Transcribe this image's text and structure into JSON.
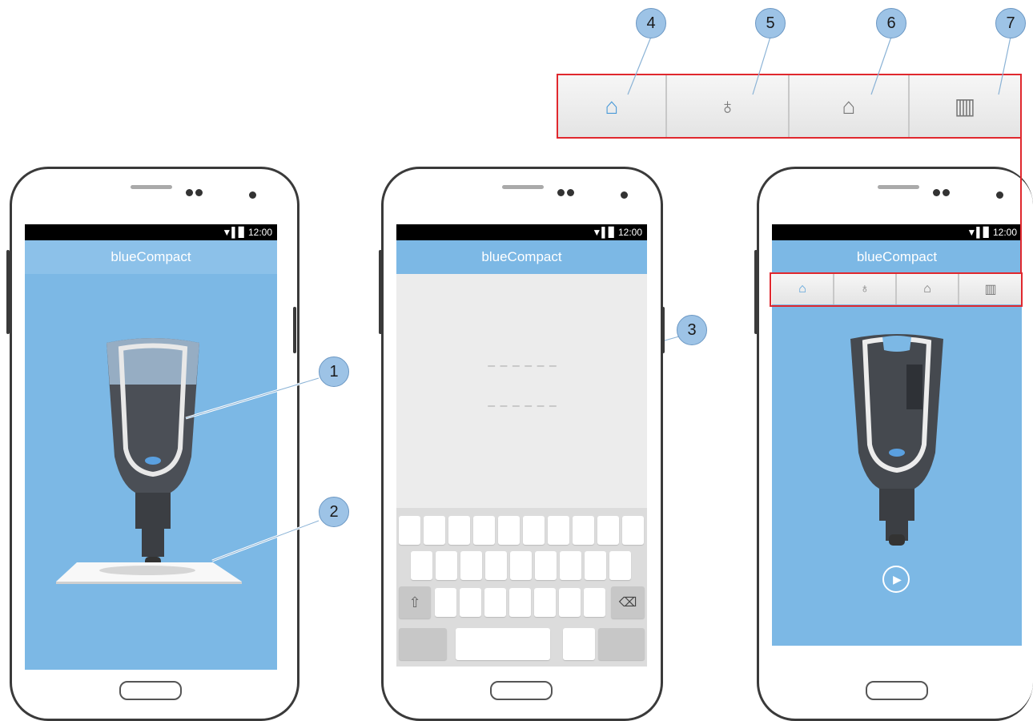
{
  "status": {
    "time": "12:00"
  },
  "app": {
    "title": "blueCompact"
  },
  "pin_entry": {
    "row1_placeholder": "– – – – – –",
    "row2_placeholder": "– – – – – –"
  },
  "callouts": [
    "1",
    "2",
    "3",
    "4",
    "5",
    "6",
    "7"
  ],
  "tabs": [
    {
      "icon": "key-icon",
      "active": true
    },
    {
      "icon": "cylinder-icon",
      "active": false
    },
    {
      "icon": "key-outline-icon",
      "active": false
    },
    {
      "icon": "book-icon",
      "active": false
    }
  ],
  "colors": {
    "app_blue": "#7cb8e5",
    "accent": "#4a9ad8",
    "highlight_red": "#e0282e",
    "callout_fill": "#9dc3e6"
  }
}
